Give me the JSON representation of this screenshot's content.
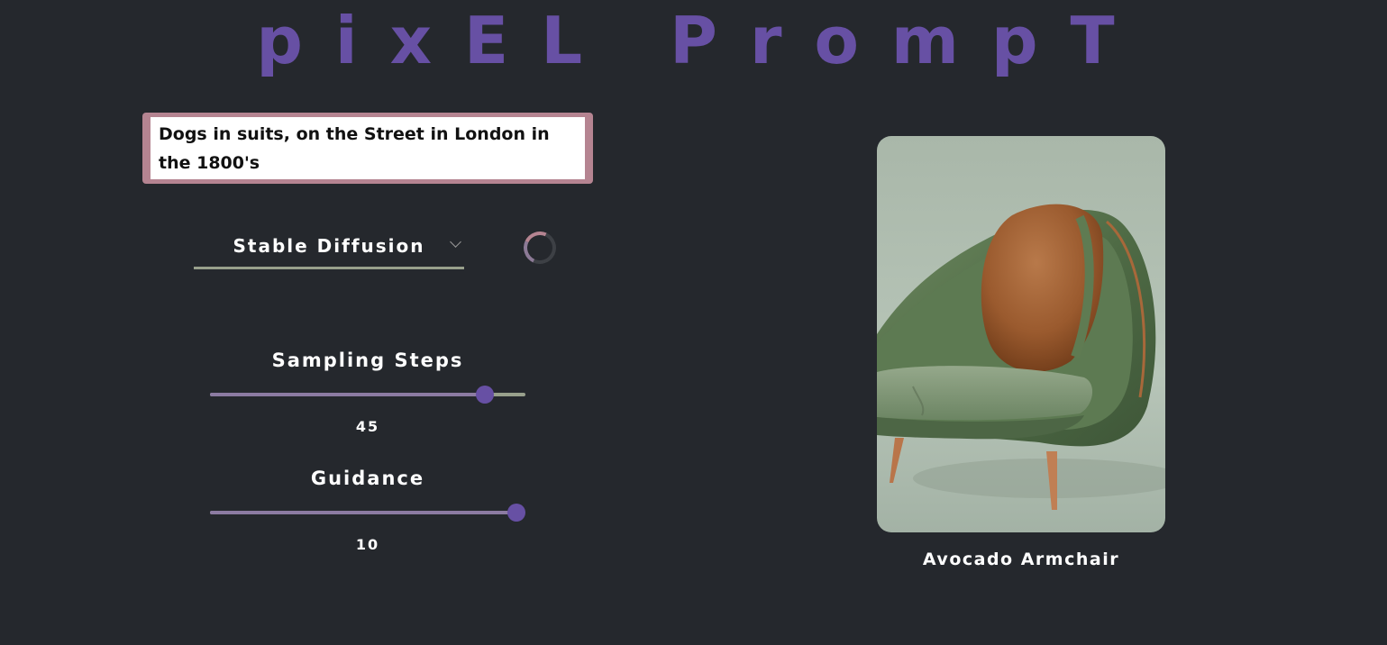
{
  "app": {
    "title": "pixEL PrompT",
    "accent_color": "#6750a4"
  },
  "prompt": {
    "value": "Dogs in suits, on the Street in London in the 1800's"
  },
  "model": {
    "selected": "Stable Diffusion",
    "icon": "chevron-down-icon"
  },
  "status": {
    "loading": true,
    "icon": "loading-spinner-icon"
  },
  "sliders": {
    "steps": {
      "label": "Sampling Steps",
      "value": "45",
      "fraction": 0.87
    },
    "guidance": {
      "label": "Guidance",
      "value": "10",
      "fraction": 1.0
    }
  },
  "result": {
    "caption": "Avocado Armchair"
  }
}
